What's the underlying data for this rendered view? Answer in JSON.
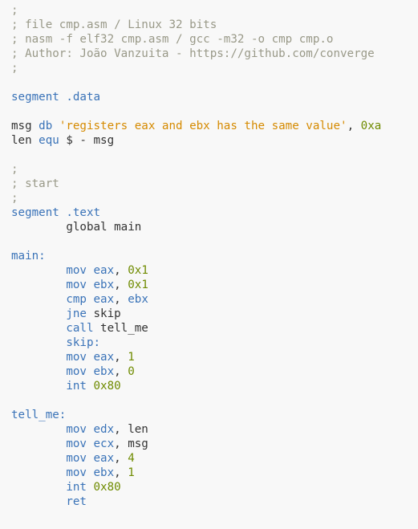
{
  "colors": {
    "background": "#f8f8f8",
    "comment": "#999988",
    "keyword": "#3a73b8",
    "string": "#d58a00",
    "number": "#6f8b00",
    "text": "#333333"
  },
  "lines": [
    [
      {
        "t": "c",
        "v": ";"
      }
    ],
    [
      {
        "t": "c",
        "v": "; file cmp.asm / Linux 32 bits"
      }
    ],
    [
      {
        "t": "c",
        "v": "; nasm -f elf32 cmp.asm / gcc -m32 -o cmp cmp.o"
      }
    ],
    [
      {
        "t": "c",
        "v": "; Author: João Vanzuita - https://github.com/converge"
      }
    ],
    [
      {
        "t": "c",
        "v": ";"
      }
    ],
    [],
    [
      {
        "t": "k",
        "v": "segment .data"
      }
    ],
    [],
    [
      {
        "t": "t",
        "v": "msg "
      },
      {
        "t": "k",
        "v": "db"
      },
      {
        "t": "t",
        "v": " "
      },
      {
        "t": "s",
        "v": "'registers eax and ebx has the same value'"
      },
      {
        "t": "t",
        "v": ", "
      },
      {
        "t": "n",
        "v": "0xa"
      }
    ],
    [
      {
        "t": "t",
        "v": "len "
      },
      {
        "t": "k",
        "v": "equ"
      },
      {
        "t": "t",
        "v": " $ - msg"
      }
    ],
    [],
    [
      {
        "t": "c",
        "v": ";"
      }
    ],
    [
      {
        "t": "c",
        "v": "; start"
      }
    ],
    [
      {
        "t": "c",
        "v": ";"
      }
    ],
    [
      {
        "t": "k",
        "v": "segment .text"
      }
    ],
    [
      {
        "t": "t",
        "v": "        global main"
      }
    ],
    [],
    [
      {
        "t": "k",
        "v": "main:"
      }
    ],
    [
      {
        "t": "t",
        "v": "        "
      },
      {
        "t": "k",
        "v": "mov eax"
      },
      {
        "t": "t",
        "v": ", "
      },
      {
        "t": "n",
        "v": "0x1"
      }
    ],
    [
      {
        "t": "t",
        "v": "        "
      },
      {
        "t": "k",
        "v": "mov ebx"
      },
      {
        "t": "t",
        "v": ", "
      },
      {
        "t": "n",
        "v": "0x1"
      }
    ],
    [
      {
        "t": "t",
        "v": "        "
      },
      {
        "t": "k",
        "v": "cmp eax"
      },
      {
        "t": "t",
        "v": ", "
      },
      {
        "t": "k",
        "v": "ebx"
      }
    ],
    [
      {
        "t": "t",
        "v": "        "
      },
      {
        "t": "k",
        "v": "jne"
      },
      {
        "t": "t",
        "v": " skip"
      }
    ],
    [
      {
        "t": "t",
        "v": "        "
      },
      {
        "t": "k",
        "v": "call"
      },
      {
        "t": "t",
        "v": " tell_me"
      }
    ],
    [
      {
        "t": "t",
        "v": "        "
      },
      {
        "t": "k",
        "v": "skip:"
      }
    ],
    [
      {
        "t": "t",
        "v": "        "
      },
      {
        "t": "k",
        "v": "mov eax"
      },
      {
        "t": "t",
        "v": ", "
      },
      {
        "t": "n",
        "v": "1"
      }
    ],
    [
      {
        "t": "t",
        "v": "        "
      },
      {
        "t": "k",
        "v": "mov ebx"
      },
      {
        "t": "t",
        "v": ", "
      },
      {
        "t": "n",
        "v": "0"
      }
    ],
    [
      {
        "t": "t",
        "v": "        "
      },
      {
        "t": "k",
        "v": "int"
      },
      {
        "t": "t",
        "v": " "
      },
      {
        "t": "n",
        "v": "0x80"
      }
    ],
    [],
    [
      {
        "t": "k",
        "v": "tell_me:"
      }
    ],
    [
      {
        "t": "t",
        "v": "        "
      },
      {
        "t": "k",
        "v": "mov edx"
      },
      {
        "t": "t",
        "v": ", len"
      }
    ],
    [
      {
        "t": "t",
        "v": "        "
      },
      {
        "t": "k",
        "v": "mov ecx"
      },
      {
        "t": "t",
        "v": ", msg"
      }
    ],
    [
      {
        "t": "t",
        "v": "        "
      },
      {
        "t": "k",
        "v": "mov eax"
      },
      {
        "t": "t",
        "v": ", "
      },
      {
        "t": "n",
        "v": "4"
      }
    ],
    [
      {
        "t": "t",
        "v": "        "
      },
      {
        "t": "k",
        "v": "mov ebx"
      },
      {
        "t": "t",
        "v": ", "
      },
      {
        "t": "n",
        "v": "1"
      }
    ],
    [
      {
        "t": "t",
        "v": "        "
      },
      {
        "t": "k",
        "v": "int"
      },
      {
        "t": "t",
        "v": " "
      },
      {
        "t": "n",
        "v": "0x80"
      }
    ],
    [
      {
        "t": "t",
        "v": "        "
      },
      {
        "t": "k",
        "v": "ret"
      }
    ]
  ]
}
